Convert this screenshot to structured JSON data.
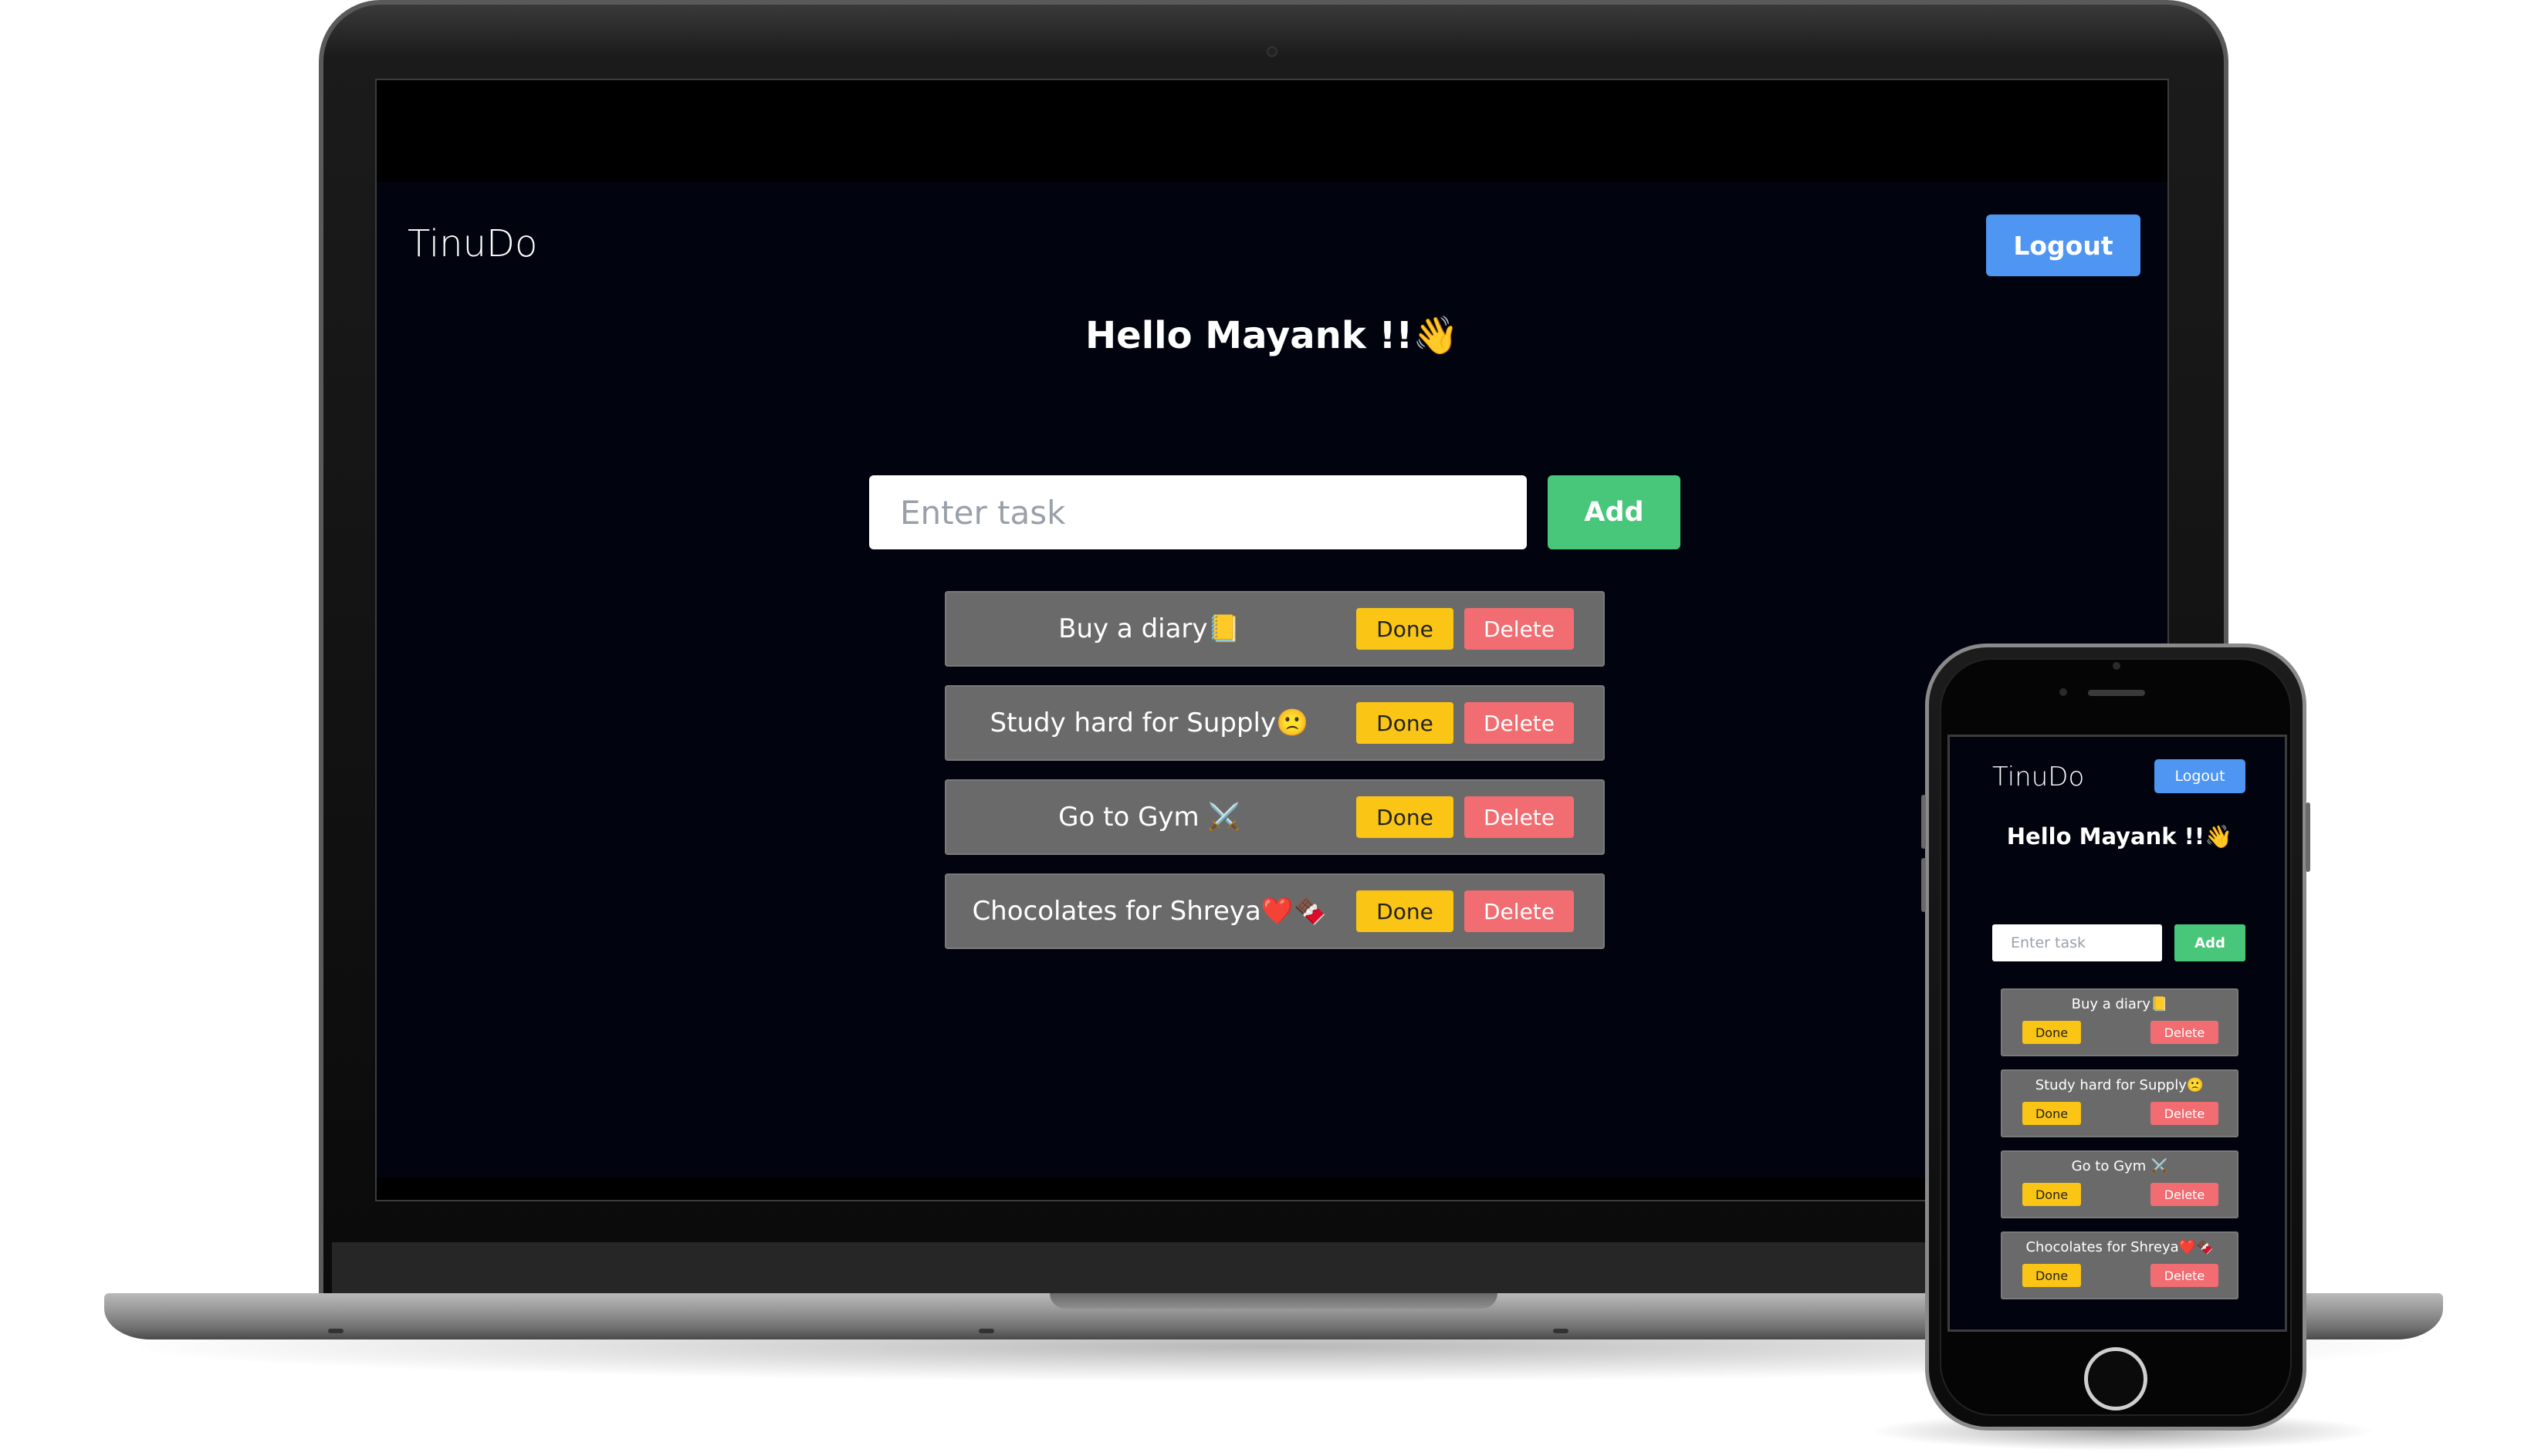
{
  "app": {
    "brand": "TinuDo",
    "logout_label": "Logout",
    "greeting": "Hello Mayank !!👋",
    "input_placeholder": "Enter task",
    "add_label": "Add",
    "done_label": "Done",
    "delete_label": "Delete"
  },
  "tasks": [
    {
      "text": "Buy a diary📒"
    },
    {
      "text": "Study hard for Supply🙁"
    },
    {
      "text": "Go to Gym ⚔️"
    },
    {
      "text": "Chocolates for Shreya❤️🍫"
    }
  ],
  "colors": {
    "background": "#01040f",
    "logout": "#4f95f2",
    "add": "#48c77a",
    "done": "#fac515",
    "delete": "#f16d71",
    "task_row": "#6a6a6a"
  }
}
